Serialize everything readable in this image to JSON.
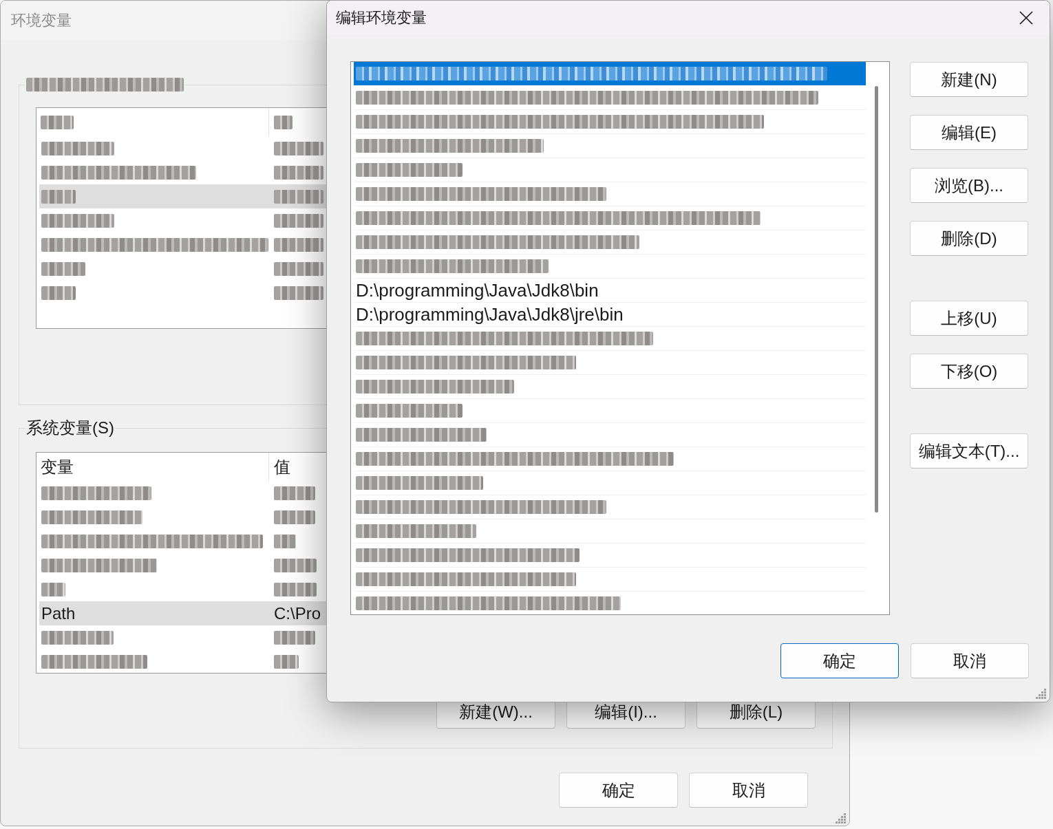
{
  "main_window": {
    "title": "环境变量",
    "user_variables": {
      "label": {
        "kind": "blurred"
      },
      "columns": [
        {
          "kind": "blurred"
        },
        {
          "kind": "blurred"
        }
      ],
      "rows": [
        {
          "kind": "blurred",
          "selected": false
        },
        {
          "kind": "blurred",
          "selected": false
        },
        {
          "kind": "blurred",
          "selected": true
        },
        {
          "kind": "blurred",
          "selected": false
        },
        {
          "kind": "blurred",
          "selected": false
        },
        {
          "kind": "blurred",
          "selected": false
        },
        {
          "kind": "blurred",
          "selected": false
        }
      ]
    },
    "system_variables": {
      "label": {
        "kind": "text",
        "text": "系统变量(S)"
      },
      "columns": [
        {
          "kind": "text",
          "text": "变量"
        },
        {
          "kind": "text",
          "text": "值"
        }
      ],
      "rows": [
        {
          "kind": "blurred",
          "selected": false
        },
        {
          "kind": "blurred",
          "selected": false
        },
        {
          "kind": "blurred",
          "selected": false
        },
        {
          "kind": "blurred",
          "selected": false
        },
        {
          "kind": "blurred",
          "selected": false
        },
        {
          "kind": "text",
          "name": "Path",
          "value": "C:\\Pro",
          "selected": true
        },
        {
          "kind": "blurred",
          "selected": false
        },
        {
          "kind": "blurred",
          "selected": false
        }
      ],
      "buttons": [
        "新建(W)...",
        "编辑(I)...",
        "删除(L)"
      ]
    },
    "buttons": [
      "确定",
      "取消"
    ]
  },
  "dialog": {
    "title": "编辑环境变量",
    "paths": [
      {
        "kind": "blurred",
        "selected": true
      },
      {
        "kind": "blurred",
        "selected": false
      },
      {
        "kind": "blurred",
        "selected": false
      },
      {
        "kind": "blurred",
        "selected": false
      },
      {
        "kind": "blurred",
        "selected": false
      },
      {
        "kind": "blurred",
        "selected": false
      },
      {
        "kind": "blurred",
        "selected": false
      },
      {
        "kind": "blurred",
        "selected": false
      },
      {
        "kind": "blurred",
        "selected": false
      },
      {
        "kind": "text",
        "text": "D:\\programming\\Java\\Jdk8\\bin",
        "selected": false
      },
      {
        "kind": "text",
        "text": "D:\\programming\\Java\\Jdk8\\jre\\bin",
        "selected": false
      },
      {
        "kind": "blurred",
        "selected": false
      },
      {
        "kind": "blurred",
        "selected": false
      },
      {
        "kind": "blurred",
        "selected": false
      },
      {
        "kind": "blurred",
        "selected": false
      },
      {
        "kind": "blurred",
        "selected": false
      },
      {
        "kind": "blurred",
        "selected": false
      },
      {
        "kind": "blurred",
        "selected": false
      },
      {
        "kind": "blurred",
        "selected": false
      },
      {
        "kind": "blurred",
        "selected": false
      },
      {
        "kind": "blurred",
        "selected": false
      },
      {
        "kind": "blurred",
        "selected": false
      },
      {
        "kind": "blurred",
        "selected": false
      }
    ],
    "side_button_groups": [
      [
        "新建(N)",
        "编辑(E)",
        "浏览(B)...",
        "删除(D)"
      ],
      [
        "上移(U)",
        "下移(O)"
      ],
      [
        "编辑文本(T)..."
      ]
    ],
    "buttons": [
      {
        "label": "确定",
        "default": true
      },
      {
        "label": "取消",
        "default": false
      }
    ]
  }
}
